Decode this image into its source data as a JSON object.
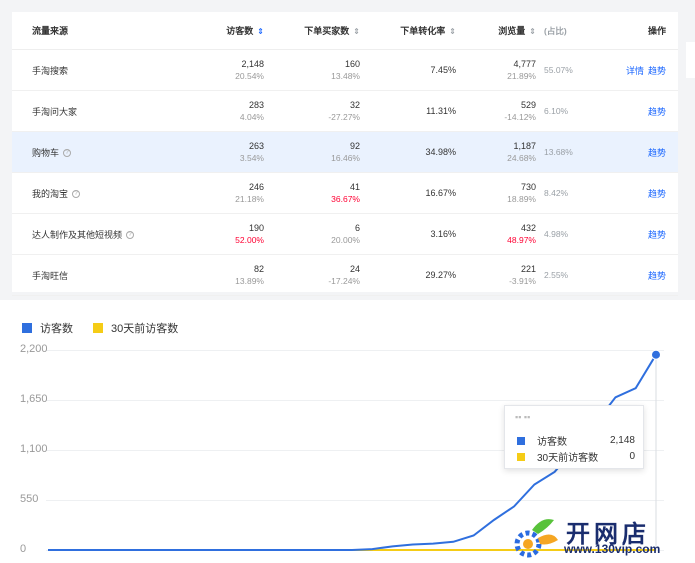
{
  "table": {
    "headers": {
      "source": "流量来源",
      "visitors": "访客数",
      "buyers": "下单买家数",
      "conversion": "下单转化率",
      "pageviews": "浏览量",
      "share": "(占比)",
      "operation": "操作"
    },
    "rows": [
      {
        "source": "手淘搜索",
        "help": false,
        "visitors": "2,148",
        "visitors_change": "20.54%",
        "visitors_neg": false,
        "buyers": "160",
        "buyers_change": "13.48%",
        "buyers_neg": false,
        "conversion": "7.45%",
        "pageviews": "4,777",
        "pageviews_change": "21.89%",
        "pageviews_neg": false,
        "share": "55.07%",
        "detail": "详情",
        "trend": "趋势",
        "highlight": false
      },
      {
        "source": "手淘问大家",
        "help": false,
        "visitors": "283",
        "visitors_change": "4.04%",
        "visitors_neg": false,
        "buyers": "32",
        "buyers_change": "-27.27%",
        "buyers_neg": false,
        "conversion": "11.31%",
        "pageviews": "529",
        "pageviews_change": "-14.12%",
        "pageviews_neg": false,
        "share": "6.10%",
        "detail": "",
        "trend": "趋势",
        "highlight": false
      },
      {
        "source": "购物车",
        "help": true,
        "visitors": "263",
        "visitors_change": "3.54%",
        "visitors_neg": false,
        "buyers": "92",
        "buyers_change": "16.46%",
        "buyers_neg": false,
        "conversion": "34.98%",
        "pageviews": "1,187",
        "pageviews_change": "24.68%",
        "pageviews_neg": false,
        "share": "13.68%",
        "detail": "",
        "trend": "趋势",
        "highlight": true
      },
      {
        "source": "我的淘宝",
        "help": true,
        "visitors": "246",
        "visitors_change": "21.18%",
        "visitors_neg": false,
        "buyers": "41",
        "buyers_change": "36.67%",
        "buyers_neg": true,
        "conversion": "16.67%",
        "pageviews": "730",
        "pageviews_change": "18.89%",
        "pageviews_neg": false,
        "share": "8.42%",
        "detail": "",
        "trend": "趋势",
        "highlight": false
      },
      {
        "source": "达人制作及其他短视频",
        "help": true,
        "visitors": "190",
        "visitors_change": "52.00%",
        "visitors_neg": true,
        "buyers": "6",
        "buyers_change": "20.00%",
        "buyers_neg": false,
        "conversion": "3.16%",
        "pageviews": "432",
        "pageviews_change": "48.97%",
        "pageviews_neg": true,
        "share": "4.98%",
        "detail": "",
        "trend": "趋势",
        "highlight": false
      },
      {
        "source": "手淘旺信",
        "help": false,
        "visitors": "82",
        "visitors_change": "13.89%",
        "visitors_neg": false,
        "buyers": "24",
        "buyers_change": "-17.24%",
        "buyers_neg": false,
        "conversion": "29.27%",
        "pageviews": "221",
        "pageviews_change": "-3.91%",
        "pageviews_neg": false,
        "share": "2.55%",
        "detail": "",
        "trend": "趋势",
        "highlight": false
      }
    ]
  },
  "colors": {
    "accent": "#1a66ff",
    "series_current": "#2f6fde",
    "series_prev": "#f5cc16",
    "negative": "#ff0033",
    "highlight_row": "#eaf2fe"
  },
  "chart_data": {
    "type": "line",
    "legend": [
      "访客数",
      "30天前访客数"
    ],
    "yticks": [
      "2,200",
      "1,650",
      "1,100",
      "550",
      "0"
    ],
    "ylim": [
      0,
      2200
    ],
    "x": [
      0,
      1,
      2,
      3,
      4,
      5,
      6,
      7,
      8,
      9,
      10,
      11,
      12,
      13,
      14,
      15,
      16,
      17,
      18,
      19,
      20,
      21,
      22,
      23,
      24,
      25,
      26,
      27,
      28,
      29,
      30
    ],
    "series": [
      {
        "name": "访客数",
        "values": [
          0,
          0,
          0,
          0,
          0,
          0,
          0,
          0,
          0,
          0,
          0,
          0,
          0,
          0,
          0,
          0,
          10,
          40,
          60,
          70,
          90,
          160,
          330,
          480,
          720,
          860,
          1120,
          1390,
          1680,
          1780,
          2148
        ]
      },
      {
        "name": "30天前访客数",
        "values": [
          0,
          0,
          0,
          0,
          0,
          0,
          0,
          0,
          0,
          0,
          0,
          0,
          0,
          0,
          0,
          0,
          0,
          0,
          0,
          0,
          0,
          0,
          0,
          0,
          0,
          0,
          0,
          0,
          0,
          0,
          0
        ]
      }
    ],
    "grid": true,
    "legend_position": "top-left"
  },
  "tooltip": {
    "rows": [
      {
        "name": "访客数",
        "value": "2,148"
      },
      {
        "name": "30天前访客数",
        "value": "0"
      }
    ]
  },
  "watermark": {
    "title": "开网店",
    "url": "www.130vip.com"
  }
}
